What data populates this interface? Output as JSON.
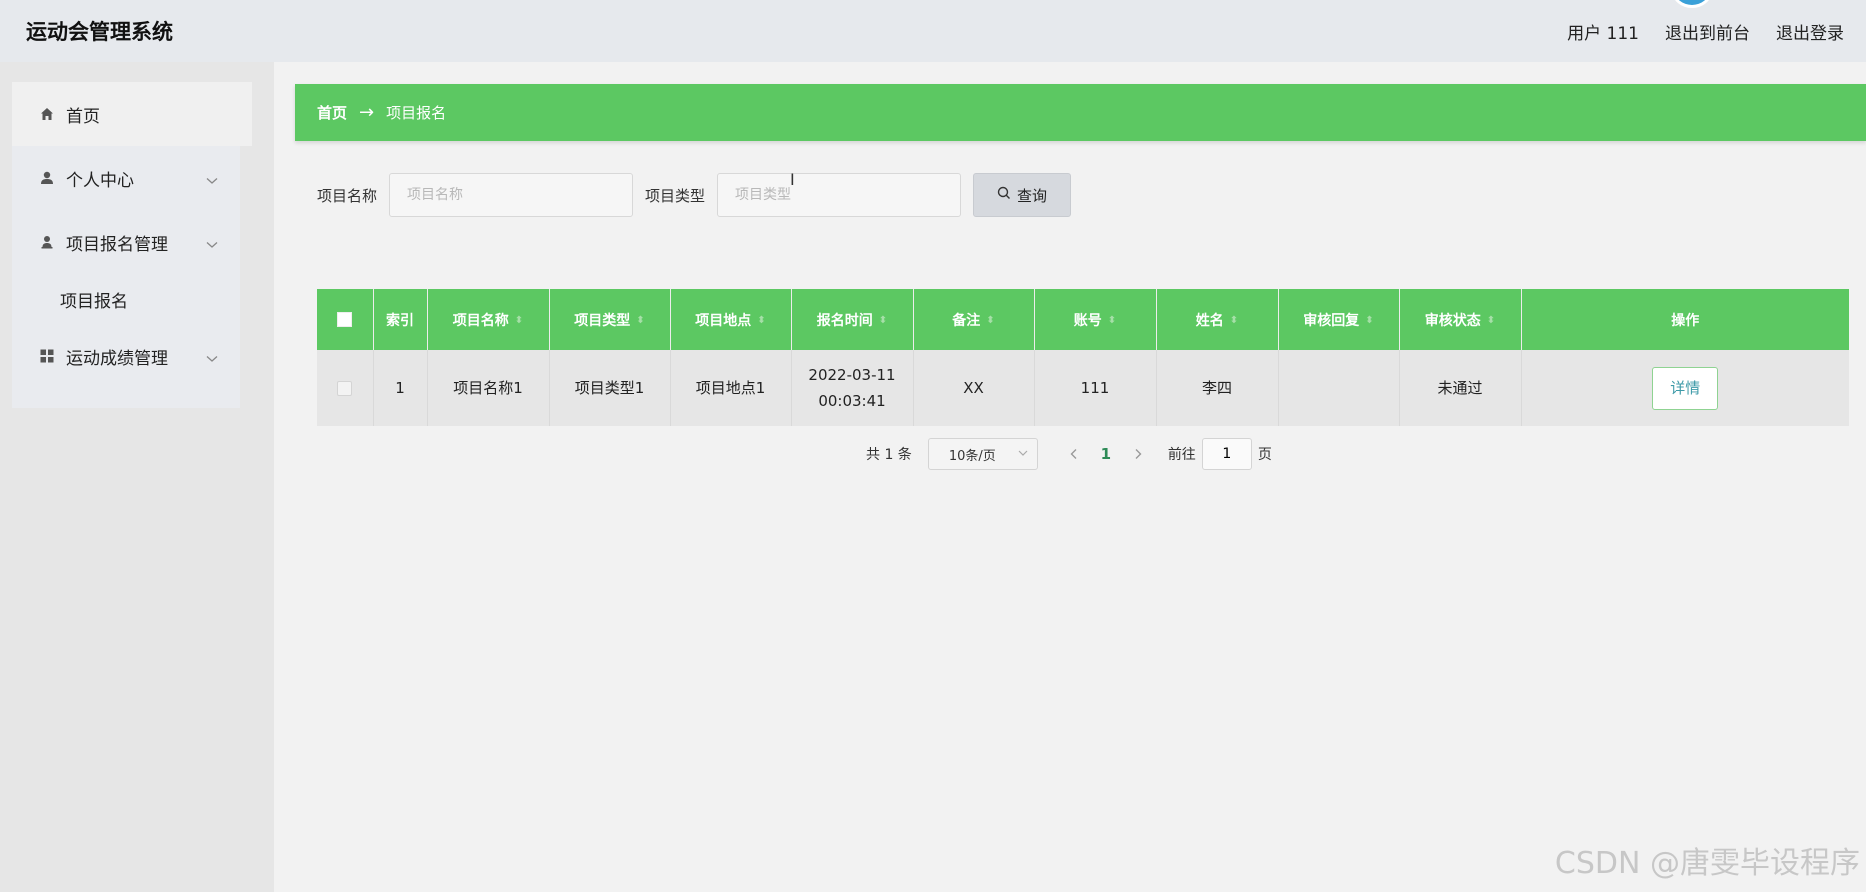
{
  "header": {
    "title": "运动会管理系统",
    "user_label": "用户 111",
    "front_label": "退出到前台",
    "logout_label": "退出登录"
  },
  "sidebar": {
    "items": [
      {
        "label": "首页",
        "icon": "home-icon"
      },
      {
        "label": "个人中心",
        "icon": "user-icon"
      },
      {
        "label": "项目报名管理",
        "icon": "user-icon"
      },
      {
        "label": "项目报名"
      },
      {
        "label": "运动成绩管理",
        "icon": "grid-icon"
      }
    ]
  },
  "breadcrumb": {
    "home": "首页",
    "arrow": "→",
    "current": "项目报名"
  },
  "search": {
    "name_label": "项目名称",
    "name_placeholder": "项目名称",
    "type_label": "项目类型",
    "type_placeholder": "项目类型",
    "button_label": "查询"
  },
  "table": {
    "columns": [
      "索引",
      "项目名称",
      "项目类型",
      "项目地点",
      "报名时间",
      "备注",
      "账号",
      "姓名",
      "审核回复",
      "审核状态",
      "操作"
    ],
    "rows": [
      {
        "index": "1",
        "name": "项目名称1",
        "type": "项目类型1",
        "location": "项目地点1",
        "date": "2022-03-11",
        "time": "00:03:41",
        "remark": "XX",
        "account": "111",
        "person": "李四",
        "reply": "",
        "status": "未通过",
        "action": "详情"
      }
    ]
  },
  "pagination": {
    "total": "共 1 条",
    "page_size": "10条/页",
    "current": "1",
    "goto_prefix": "前往",
    "goto_value": "1",
    "goto_suffix": "页"
  },
  "watermark": "CSDN @唐雯毕设程序",
  "colors": {
    "accent": "#5cc862",
    "header_bg": "#e6e9ed",
    "sidebar_bg": "#e6e6e6",
    "page_bg": "#f2f2f2"
  }
}
